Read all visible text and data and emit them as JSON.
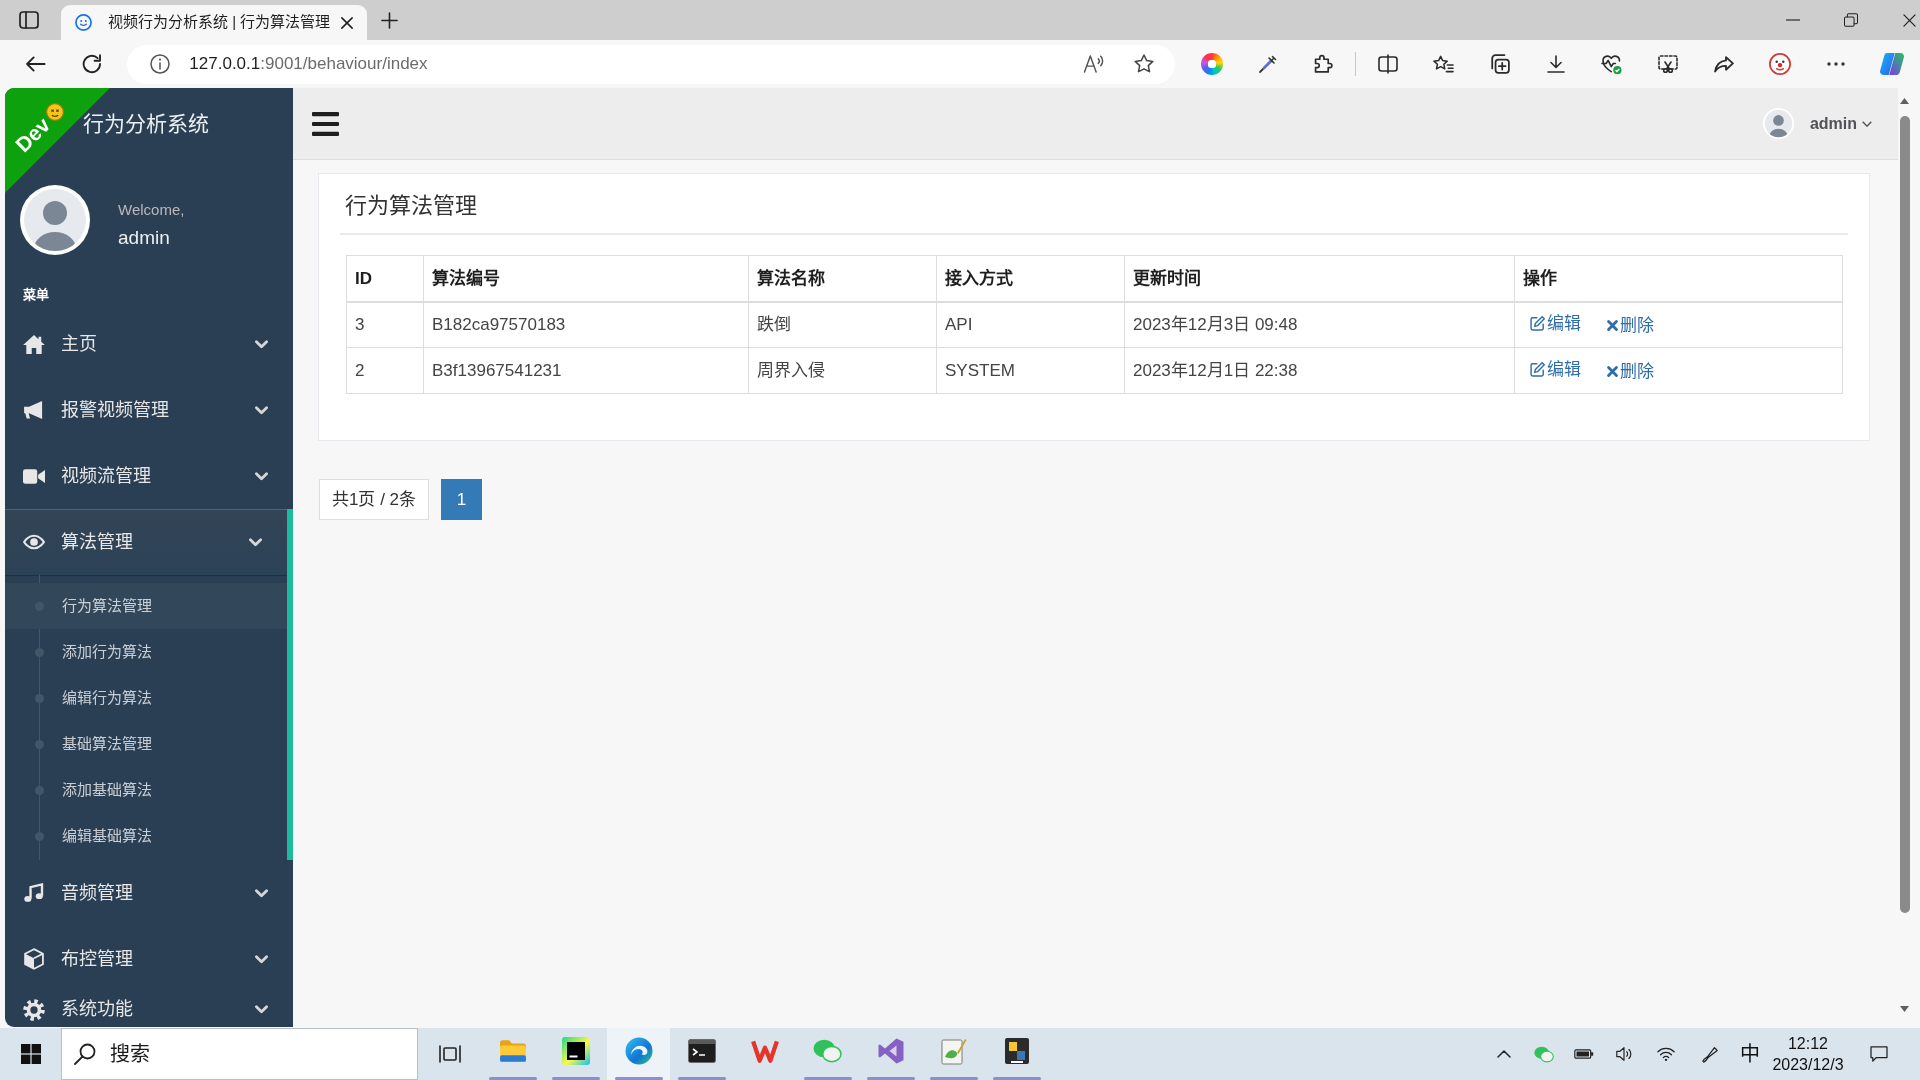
{
  "browser": {
    "tabs": [
      {
        "title": "视频行为分析系统 | 行为算法管理",
        "selected": true
      }
    ],
    "address": {
      "host": "127.0.0.1",
      "path": ":9001/behaviour/index"
    }
  },
  "sidebar": {
    "ribbon": "Dev",
    "title": "行为分析系统",
    "welcome": "Welcome,",
    "user": "admin",
    "menu_heading": "菜单",
    "items": [
      {
        "label": "主页",
        "expanded": false
      },
      {
        "label": "报警视频管理",
        "expanded": false
      },
      {
        "label": "视频流管理",
        "expanded": false
      },
      {
        "label": "算法管理",
        "expanded": true,
        "children": [
          {
            "label": "行为算法管理",
            "selected": true
          },
          {
            "label": "添加行为算法",
            "selected": false
          },
          {
            "label": "编辑行为算法",
            "selected": false
          },
          {
            "label": "基础算法管理",
            "selected": false
          },
          {
            "label": "添加基础算法",
            "selected": false
          },
          {
            "label": "编辑基础算法",
            "selected": false
          }
        ]
      },
      {
        "label": "音频管理",
        "expanded": false
      },
      {
        "label": "布控管理",
        "expanded": false
      },
      {
        "label": "系统功能",
        "expanded": false
      }
    ]
  },
  "top_nav": {
    "user": "admin"
  },
  "panel": {
    "title": "行为算法管理",
    "table": {
      "columns": [
        "ID",
        "算法编号",
        "算法名称",
        "接入方式",
        "更新时间",
        "操作"
      ],
      "rows": [
        {
          "cells": [
            "3",
            "B182ca97570183",
            "跌倒",
            "API",
            "2023年12月3日 09:48"
          ],
          "actions": [
            {
              "kind": "edit",
              "label": "编辑"
            },
            {
              "kind": "delete",
              "label": "删除"
            }
          ]
        },
        {
          "cells": [
            "2",
            "B3f13967541231",
            "周界入侵",
            "SYSTEM",
            "2023年12月1日 22:38"
          ],
          "actions": [
            {
              "kind": "edit",
              "label": "编辑"
            },
            {
              "kind": "delete",
              "label": "删除"
            }
          ]
        }
      ]
    }
  },
  "pagination": {
    "summary": "共1页 / 2条",
    "pages": [
      {
        "label": "1",
        "selected": true
      }
    ]
  },
  "taskbar": {
    "search": {
      "placeholder": "搜索"
    },
    "apps": [
      {
        "kind": "folder",
        "running": true,
        "selected": false
      },
      {
        "kind": "ide",
        "running": true,
        "selected": false
      },
      {
        "kind": "browser",
        "running": true,
        "selected": true
      },
      {
        "kind": "terminal",
        "running": true,
        "selected": false
      },
      {
        "kind": "office",
        "running": false,
        "selected": false
      },
      {
        "kind": "chat",
        "running": true,
        "selected": false
      },
      {
        "kind": "studio",
        "running": true,
        "selected": false
      },
      {
        "kind": "editor",
        "running": true,
        "selected": false
      },
      {
        "kind": "launcher",
        "running": true,
        "selected": false
      }
    ],
    "ime": "中",
    "time": "12:12",
    "date": "2023/12/3"
  }
}
